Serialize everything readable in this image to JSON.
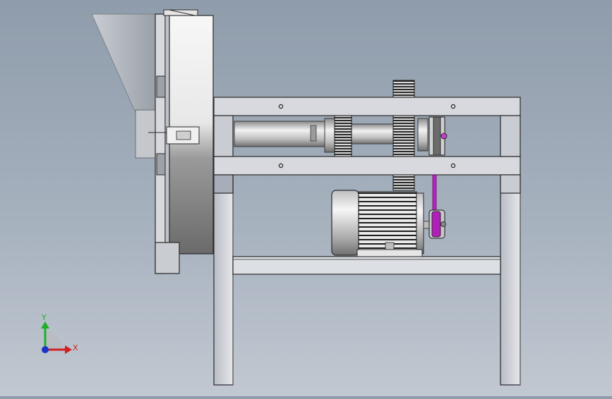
{
  "window": {
    "title": ""
  },
  "viewport": {
    "background_top": "#8f9cab",
    "background_bottom": "#c1c8d1"
  },
  "triad": {
    "x_label": "X",
    "y_label": "Y",
    "x_color": "#d21f1f",
    "y_color": "#1fae2a",
    "z_color": "#1c33c8"
  },
  "colors": {
    "steel_light": "#f4f4f4",
    "steel_dark": "#6b6b6b",
    "frame_fill": "#d9dbe0",
    "frame_edge": "#2a2a2a",
    "belt": "#c020c8"
  },
  "model": {
    "parts": [
      "feed-hopper",
      "cutter-housing",
      "main-shaft",
      "spur-gear-small",
      "spur-gear-large",
      "shaft-pulley",
      "v-belt",
      "electric-motor",
      "motor-pulley",
      "upper-frame",
      "motor-base",
      "support-legs"
    ]
  }
}
